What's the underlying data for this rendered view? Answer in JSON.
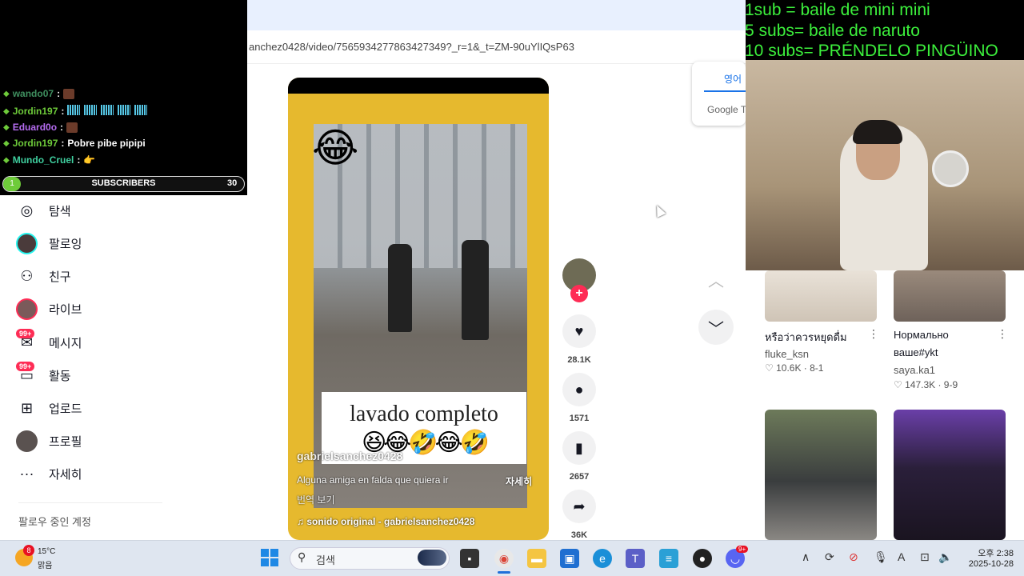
{
  "browser": {
    "url": "anchez0428/video/7565934277863427349?_r=1&_t=ZM-90uYlIQsP63"
  },
  "stream_chat": {
    "messages": [
      {
        "user": "wando07",
        "text": "",
        "user_color": "#3f8f5f"
      },
      {
        "user": "Jordin197",
        "text": "",
        "user_color": "#6ecb3a"
      },
      {
        "user": "Eduard0o",
        "text": "",
        "user_color": "#b56cf0"
      },
      {
        "user": "Jordin197",
        "text": "Pobre pibe pipipi",
        "user_color": "#6ecb3a"
      },
      {
        "user": "Mundo_Cruel",
        "text": "",
        "user_color": "#3fcf9f"
      }
    ],
    "subscribers_label": "SUBSCRIBERS",
    "subscribers_count": "30",
    "subscribers_progress": "1"
  },
  "sub_goals": [
    "1sub = baile de mini mini",
    "5 subs= baile de naruto",
    "10 subs= PRÉNDELO PINGÜINO"
  ],
  "sidebar": {
    "items": [
      {
        "label": "탐색",
        "icon": "compass-icon",
        "glyph": "◎"
      },
      {
        "label": "팔로잉",
        "icon": "following-avatar",
        "glyph": ""
      },
      {
        "label": "친구",
        "icon": "friends-icon",
        "glyph": "⚇"
      },
      {
        "label": "라이브",
        "icon": "live-avatar",
        "glyph": ""
      },
      {
        "label": "메시지",
        "icon": "message-icon",
        "glyph": "✉",
        "badge": "99+"
      },
      {
        "label": "활동",
        "icon": "activity-icon",
        "glyph": "▭",
        "badge": "99+"
      },
      {
        "label": "업로드",
        "icon": "upload-icon",
        "glyph": "⊞"
      },
      {
        "label": "프로필",
        "icon": "profile-avatar",
        "glyph": ""
      },
      {
        "label": "자세히",
        "icon": "more-icon",
        "glyph": "···"
      }
    ],
    "following_accounts_label": "팔로우 중인 계정"
  },
  "video": {
    "overlay_caption": "lavado completo",
    "overlay_emojis": "😆😂🤣😂🤣",
    "author": "gabrielsanchez0428",
    "description": "Alguna amiga en falda que quiera ir",
    "more_label": "자세히",
    "translate_label": "번역 보기",
    "sound": "♫  sonido original - gabrielsanchez0428"
  },
  "actions": {
    "likes": "28.1K",
    "comments": "1571",
    "saves": "2657",
    "shares": "36K"
  },
  "translate_popup": {
    "language": "영어",
    "brand": "Google Tr"
  },
  "recommendations": [
    {
      "title": "หรือว่าควรหยุดดื่ม",
      "author": "fluke_ksn",
      "likes": "♡ 10.6K · 8-1"
    },
    {
      "title": "Нормально",
      "title2": "ваше#ykt",
      "author": "saya.ka1",
      "likes": "♡ 147.3K · 9-9"
    }
  ],
  "taskbar": {
    "weather_badge": "8",
    "temperature": "15°C",
    "condition": "맑음",
    "search_placeholder": "검색",
    "clock_time": "오후 2:38",
    "clock_date": "2025-10-28",
    "notification_badge": "9+"
  },
  "colors": {
    "accent": "#fe2c55",
    "goal_text": "#3cf03c",
    "video_bg": "#e6b92e"
  }
}
